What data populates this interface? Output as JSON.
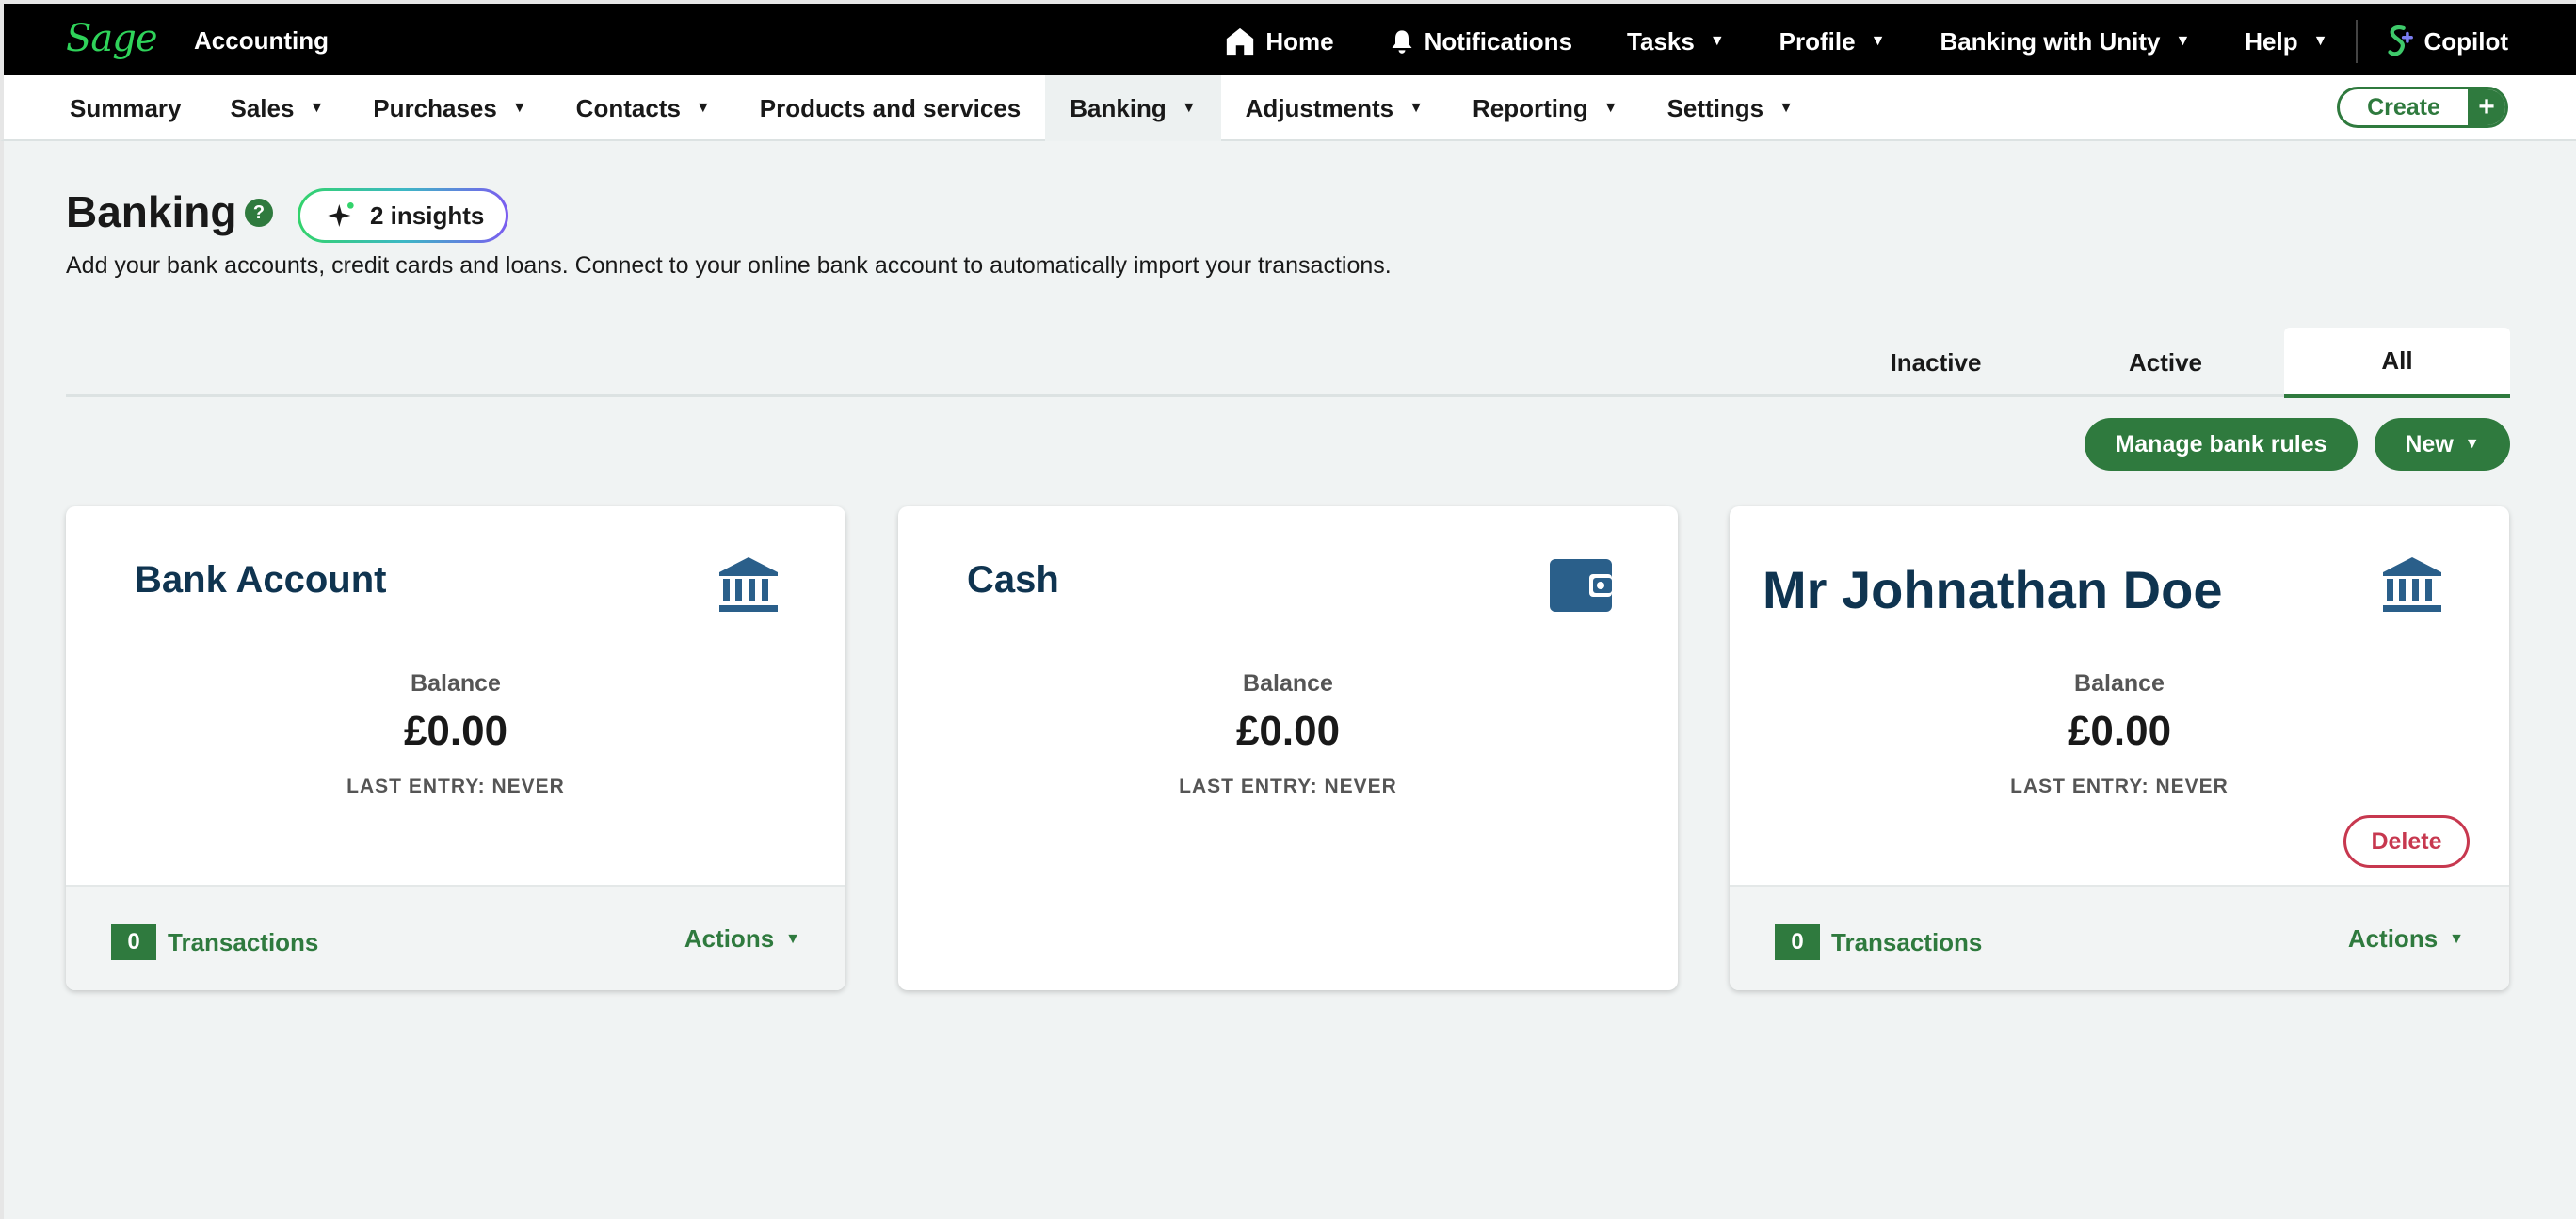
{
  "topbar": {
    "logo": "Sage",
    "app_name": "Accounting",
    "nav": [
      {
        "label": "Home",
        "icon": "home-icon"
      },
      {
        "label": "Notifications",
        "icon": "bell-icon"
      },
      {
        "label": "Tasks",
        "dropdown": true
      },
      {
        "label": "Profile",
        "dropdown": true
      },
      {
        "label": "Banking with Unity",
        "dropdown": true
      },
      {
        "label": "Help",
        "dropdown": true
      },
      {
        "label": "Copilot",
        "icon": "copilot-icon"
      }
    ]
  },
  "subnav": {
    "items": [
      {
        "label": "Summary",
        "dropdown": false
      },
      {
        "label": "Sales",
        "dropdown": true
      },
      {
        "label": "Purchases",
        "dropdown": true
      },
      {
        "label": "Contacts",
        "dropdown": true
      },
      {
        "label": "Products and services",
        "dropdown": false
      },
      {
        "label": "Banking",
        "dropdown": true,
        "active": true
      },
      {
        "label": "Adjustments",
        "dropdown": true
      },
      {
        "label": "Reporting",
        "dropdown": true
      },
      {
        "label": "Settings",
        "dropdown": true
      }
    ],
    "create_label": "Create"
  },
  "page": {
    "title": "Banking",
    "help_glyph": "?",
    "insights_label": "2 insights",
    "description": "Add your bank accounts, credit cards and loans. Connect to your online bank account to automatically import your transactions."
  },
  "tabs": {
    "inactive": "Inactive",
    "active": "Active",
    "all": "All",
    "selected": "All"
  },
  "actions": {
    "manage_rules": "Manage bank rules",
    "new": "New"
  },
  "cards": [
    {
      "name": "Bank Account",
      "icon": "bank-icon",
      "balance_label": "Balance",
      "balance": "£0.00",
      "last_entry": "LAST ENTRY: NEVER",
      "transactions_count": "0",
      "transactions_label": "Transactions",
      "actions_label": "Actions"
    },
    {
      "name": "Cash",
      "icon": "wallet-icon",
      "balance_label": "Balance",
      "balance": "£0.00",
      "last_entry": "LAST ENTRY: NEVER"
    },
    {
      "name": "Mr Johnathan Doe",
      "icon": "bank-icon",
      "balance_label": "Balance",
      "balance": "£0.00",
      "last_entry": "LAST ENTRY: NEVER",
      "delete_label": "Delete",
      "transactions_count": "0",
      "transactions_label": "Transactions",
      "actions_label": "Actions"
    }
  ],
  "colors": {
    "brand_green": "#2f7a3e",
    "logo_green": "#2fd35a",
    "card_title": "#0f3450",
    "icon_blue": "#2a5f8a",
    "danger": "#c7384f"
  }
}
